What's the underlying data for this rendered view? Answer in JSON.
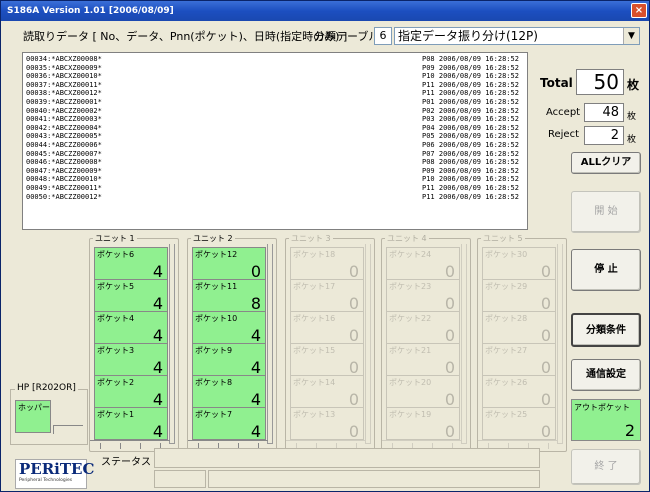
{
  "window": {
    "title": "S186A Version 1.01 [2006/08/09]",
    "close": "×"
  },
  "header": {
    "read_label": "読取りデータ [ No、データ、Pnn(ポケット)、日時(指定時のみ) ]",
    "table_label": "分類テーブル",
    "table_number": "6",
    "sort_mode": "指定データ振り分け(12P)"
  },
  "log": [
    {
      "left": "00034:*ABCXZ00008*",
      "right": "P08 2006/08/09 16:28:52"
    },
    {
      "left": "00035:*ABCXZ00009*",
      "right": "P09 2006/08/09 16:28:52"
    },
    {
      "left": "00036:*ABCXZ00010*",
      "right": "P10 2006/08/09 16:28:52"
    },
    {
      "left": "00037:*ABCXZ00011*",
      "right": "P11 2006/08/09 16:28:52"
    },
    {
      "left": "00038:*ABCXZ00012*",
      "right": "P11 2006/08/09 16:28:52"
    },
    {
      "left": "00039:*ABCZZ00001*",
      "right": "P01 2006/08/09 16:28:52"
    },
    {
      "left": "00040:*ABCZZ00002*",
      "right": "P02 2006/08/09 16:28:52"
    },
    {
      "left": "00041:*ABCZZ00003*",
      "right": "P03 2006/08/09 16:28:52"
    },
    {
      "left": "00042:*ABCZZ00004*",
      "right": "P04 2006/08/09 16:28:52"
    },
    {
      "left": "00043:*ABCZZ00005*",
      "right": "P05 2006/08/09 16:28:52"
    },
    {
      "left": "00044:*ABCZZ00006*",
      "right": "P06 2006/08/09 16:28:52"
    },
    {
      "left": "00045:*ABCZZ00007*",
      "right": "P07 2006/08/09 16:28:52"
    },
    {
      "left": "00046:*ABCZZ00008*",
      "right": "P08 2006/08/09 16:28:52"
    },
    {
      "left": "00047:*ABCZZ00009*",
      "right": "P09 2006/08/09 16:28:52"
    },
    {
      "left": "00048:*ABCZZ00010*",
      "right": "P10 2006/08/09 16:28:52"
    },
    {
      "left": "00049:*ABCZZ00011*",
      "right": "P11 2006/08/09 16:28:52"
    },
    {
      "left": "00050:*ABCZZ00012*",
      "right": "P11 2006/08/09 16:28:52"
    }
  ],
  "stats": {
    "total_label": "Total",
    "total_value": "50",
    "total_unit": "枚",
    "accept_label": "Accept",
    "accept_value": "48",
    "accept_unit": "枚",
    "reject_label": "Reject",
    "reject_value": "2",
    "reject_unit": "枚"
  },
  "buttons": {
    "all_clear": "ALLクリア",
    "start": "開 始",
    "stop": "停 止",
    "sort_condition": "分類条件",
    "comm_settings": "通信設定",
    "exit": "終 了"
  },
  "units": [
    {
      "label": "ユニット 1",
      "pockets": [
        {
          "name": "ポケット6",
          "count": "4"
        },
        {
          "name": "ポケット5",
          "count": "4"
        },
        {
          "name": "ポケット4",
          "count": "4"
        },
        {
          "name": "ポケット3",
          "count": "4"
        },
        {
          "name": "ポケット2",
          "count": "4"
        },
        {
          "name": "ポケット1",
          "count": "4"
        }
      ]
    },
    {
      "label": "ユニット 2",
      "pockets": [
        {
          "name": "ポケット12",
          "count": "0"
        },
        {
          "name": "ポケット11",
          "count": "8"
        },
        {
          "name": "ポケット10",
          "count": "4"
        },
        {
          "name": "ポケット9",
          "count": "4"
        },
        {
          "name": "ポケット8",
          "count": "4"
        },
        {
          "name": "ポケット7",
          "count": "4"
        }
      ]
    },
    {
      "label": "ユニット 3",
      "pockets": [
        {
          "name": "ポケット18",
          "count": "0"
        },
        {
          "name": "ポケット17",
          "count": "0"
        },
        {
          "name": "ポケット16",
          "count": "0"
        },
        {
          "name": "ポケット15",
          "count": "0"
        },
        {
          "name": "ポケット14",
          "count": "0"
        },
        {
          "name": "ポケット13",
          "count": "0"
        }
      ]
    },
    {
      "label": "ユニット 4",
      "pockets": [
        {
          "name": "ポケット24",
          "count": "0"
        },
        {
          "name": "ポケット23",
          "count": "0"
        },
        {
          "name": "ポケット22",
          "count": "0"
        },
        {
          "name": "ポケット21",
          "count": "0"
        },
        {
          "name": "ポケット20",
          "count": "0"
        },
        {
          "name": "ポケット19",
          "count": "0"
        }
      ]
    },
    {
      "label": "ユニット 5",
      "pockets": [
        {
          "name": "ポケット30",
          "count": "0"
        },
        {
          "name": "ポケット29",
          "count": "0"
        },
        {
          "name": "ポケット28",
          "count": "0"
        },
        {
          "name": "ポケット27",
          "count": "0"
        },
        {
          "name": "ポケット26",
          "count": "0"
        },
        {
          "name": "ポケット25",
          "count": "0"
        }
      ]
    }
  ],
  "hopper": {
    "group_label": "HP [R202OR]",
    "label": "ホッパー"
  },
  "out_pocket": {
    "label": "アウトポケット",
    "count": "2"
  },
  "status": {
    "label": "ステータス"
  },
  "logo": {
    "brand": "PERiTEC",
    "sub": "Peripheral Technologies"
  },
  "colors": {
    "pocket_active": "#90f090",
    "titlebar": "#1c4fc0"
  }
}
